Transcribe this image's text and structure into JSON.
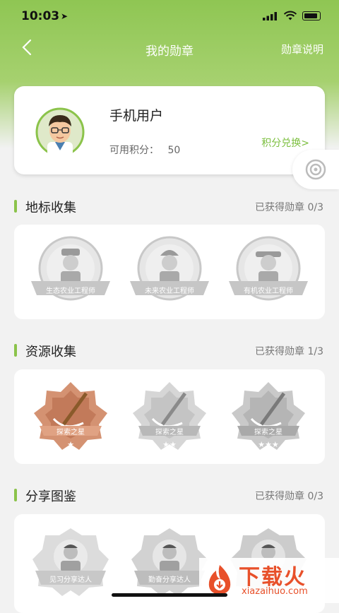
{
  "status_bar": {
    "time": "10:03"
  },
  "nav": {
    "title": "我的勋章",
    "right_link": "勋章说明"
  },
  "user": {
    "name": "手机用户",
    "points_label": "可用积分：",
    "points": "50",
    "exchange_link": "积分兑换>"
  },
  "sections": [
    {
      "title": "地标收集",
      "count": "已获得勋章 0/3",
      "badges": [
        {
          "label": "生态农业工程师",
          "earned": false
        },
        {
          "label": "未来农业工程师",
          "earned": false
        },
        {
          "label": "有机农业工程师",
          "earned": false
        }
      ]
    },
    {
      "title": "资源收集",
      "count": "已获得勋章 1/3",
      "badges": [
        {
          "label": "探索之星",
          "earned": true
        },
        {
          "label": "探索之星",
          "earned": false
        },
        {
          "label": "探索之星",
          "earned": false
        }
      ]
    },
    {
      "title": "分享图鉴",
      "count": "已获得勋章 0/3",
      "badges": [
        {
          "label": "见习分享达人",
          "earned": false
        },
        {
          "label": "勤奋分享达人",
          "earned": false
        },
        {
          "label": "",
          "earned": false
        }
      ]
    }
  ],
  "watermark": {
    "brand": "下载火",
    "url": "xiazaihuo.com"
  },
  "colors": {
    "accent": "#8bc34a",
    "link": "#7cbf3f",
    "bronze": "#d08a6a",
    "locked": "#cfcfcf"
  }
}
